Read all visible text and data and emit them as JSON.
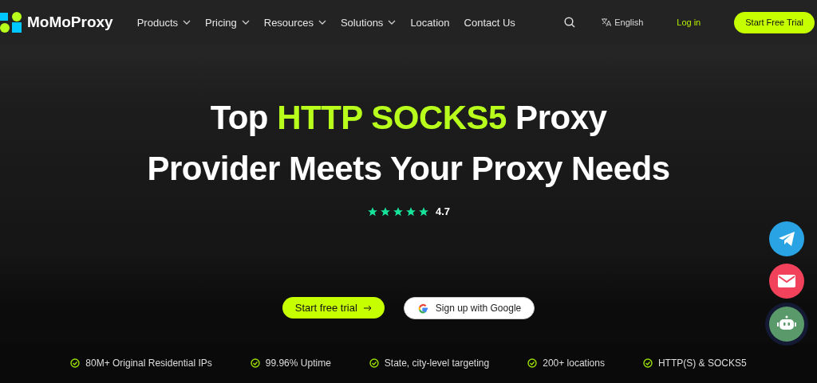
{
  "header": {
    "logo": "MoMoProxy",
    "nav": [
      {
        "label": "Products",
        "dropdown": true
      },
      {
        "label": "Pricing",
        "dropdown": true
      },
      {
        "label": "Resources",
        "dropdown": true
      },
      {
        "label": "Solutions",
        "dropdown": true
      },
      {
        "label": "Location",
        "dropdown": false
      },
      {
        "label": "Contact Us",
        "dropdown": false
      }
    ],
    "language": "English",
    "login": "Log in",
    "cta": "Start Free Trial"
  },
  "hero": {
    "title_before": "Top ",
    "title_highlight": "HTTP SOCKS5",
    "title_after": " Proxy",
    "title_line2": "Provider Meets Your Proxy Needs",
    "stars": 5,
    "rating": "4.7",
    "primary_button": "Start free trial",
    "google_button": "Sign up with Google"
  },
  "features": [
    "80M+ Original Residential IPs",
    "99.96% Uptime",
    "State, city-level targeting",
    "200+ locations",
    "HTTP(S) & SOCKS5"
  ]
}
